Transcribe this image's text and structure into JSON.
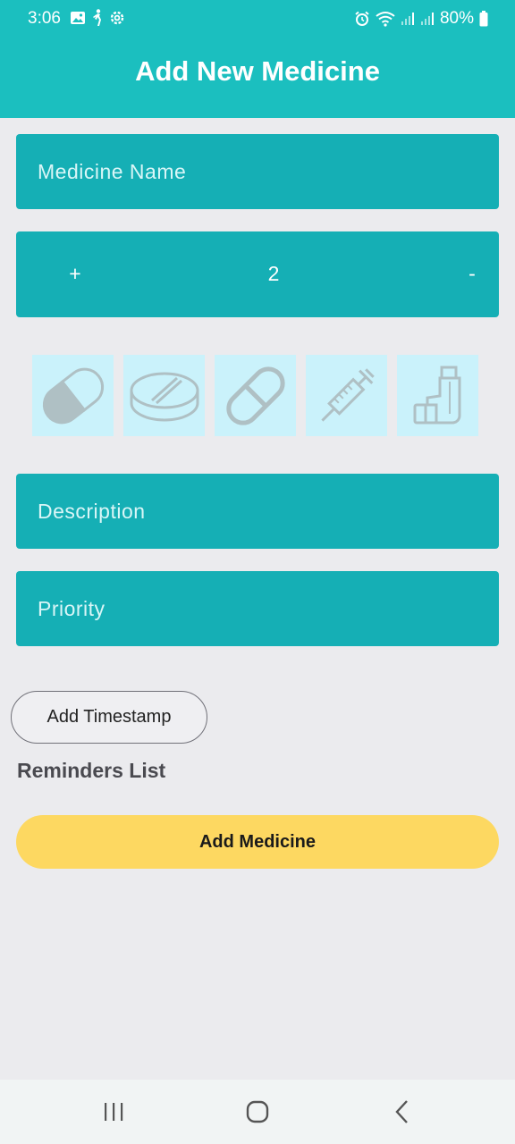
{
  "status_bar": {
    "time": "3:06",
    "battery": "80%",
    "left_icons": [
      "gallery-icon",
      "walk-icon",
      "settings-icon"
    ],
    "right_icons": [
      "alarm-icon",
      "wifi-icon",
      "signal-icon",
      "signal-icon",
      "battery-icon"
    ]
  },
  "header": {
    "title": "Add New Medicine"
  },
  "form": {
    "medicine_name_placeholder": "Medicine Name",
    "stepper": {
      "plus": "+",
      "value": "2",
      "minus": "-"
    },
    "medicine_types": [
      "capsule-icon",
      "tablet-icon",
      "pill-icon",
      "syringe-icon",
      "inhaler-icon"
    ],
    "description_placeholder": "Description",
    "priority_placeholder": "Priority"
  },
  "add_timestamp_label": "Add Timestamp",
  "reminders_list_label": "Reminders List",
  "add_medicine_label": "Add Medicine",
  "nav": {
    "icons": [
      "recents-icon",
      "home-icon",
      "back-icon"
    ]
  },
  "colors": {
    "header": "#1bbfbf",
    "field": "#15afb5",
    "tile": "#caf2fb",
    "button": "#fdd861",
    "background": "#ebebee"
  }
}
